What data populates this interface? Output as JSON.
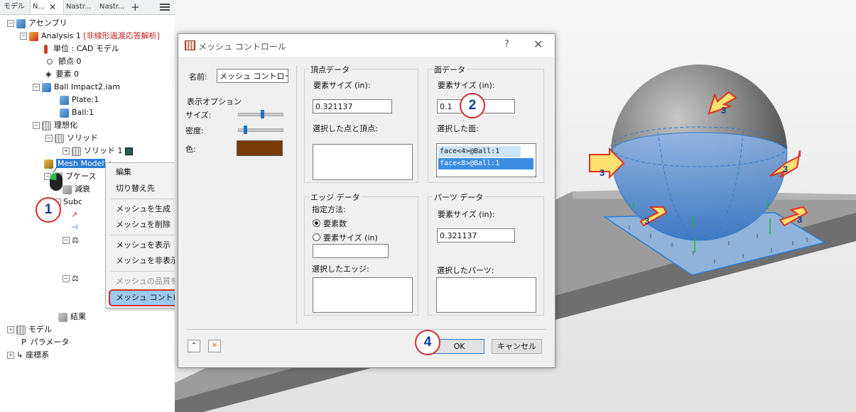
{
  "browser": {
    "tabs": [
      "モデル",
      "N...",
      "Nastr...",
      "Nastr..."
    ],
    "tree": {
      "assembly": "アセンブリ",
      "analysis": "Analysis 1",
      "analysis_type": "[非線形過渡応答解析]",
      "units": "単位 : CAD モデル",
      "nodes": "節点 0",
      "elements": "要素 0",
      "ball_impact": "Ball Impact2.iam",
      "plate": "Plate:1",
      "ball": "Ball:1",
      "idealization": "理想化",
      "solid": "ソリッド",
      "solid1": "ソリッド 1",
      "mesh_model": "Mesh Model",
      "subcase_group": "ブケース",
      "damping": "減衰",
      "subcase": "Subc",
      "results": "結果",
      "model": "モデル",
      "parameters": "パラメータ",
      "coordinates": "座標系"
    }
  },
  "context_menu": {
    "items": [
      "編集",
      "切り替え先",
      "メッシュを生成",
      "メッシュを削除",
      "メッシュを表示",
      "メッシュを非表示",
      "メッシュの品質を確認",
      "メッシュ コントロールを追加"
    ]
  },
  "dialog": {
    "title": "メッシュ コントロール",
    "help": "?",
    "close": "✕",
    "name_label": "名前:",
    "name_value": "メッシュ コントロール",
    "display_options": {
      "title": "表示オプション",
      "size_label": "サイズ:",
      "density_label": "密度:",
      "color_label": "色:",
      "size_level": 0.55,
      "density_level": 0.12,
      "color": "#7a3a08"
    },
    "vertex": {
      "title": "頂点データ",
      "size_label": "要素サイズ (in):",
      "size_value": "0.321137",
      "selected_label": "選択した点と頂点:"
    },
    "face": {
      "title": "面データ",
      "size_label": "要素サイズ (in):",
      "size_value": "0.1",
      "selected_label": "選択した面:",
      "selected_items": [
        "face<4>@Ball:1",
        "face<8>@Ball:1"
      ]
    },
    "edge": {
      "title": "エッジ データ",
      "method_label": "指定方法:",
      "opt_count": "要素数",
      "opt_size": "要素サイズ (in)",
      "selected_label": "選択したエッジ:"
    },
    "part": {
      "title": "パーツ データ",
      "size_label": "要素サイズ (in):",
      "size_value": "0.321137",
      "selected_label": "選択したパーツ:"
    },
    "ok": "OK",
    "cancel": "キャンセル",
    "collapse_icon": "double-chevron-up",
    "reset_icon": "star-burst"
  },
  "callouts": [
    "1",
    "2",
    "3",
    "4"
  ],
  "colors": {
    "accent": "#2a7bd6",
    "callout_border": "#d22c2c",
    "callout_text": "#123a9a",
    "arrow_fill": "#ffe070",
    "arrow_stroke": "#e03020"
  }
}
